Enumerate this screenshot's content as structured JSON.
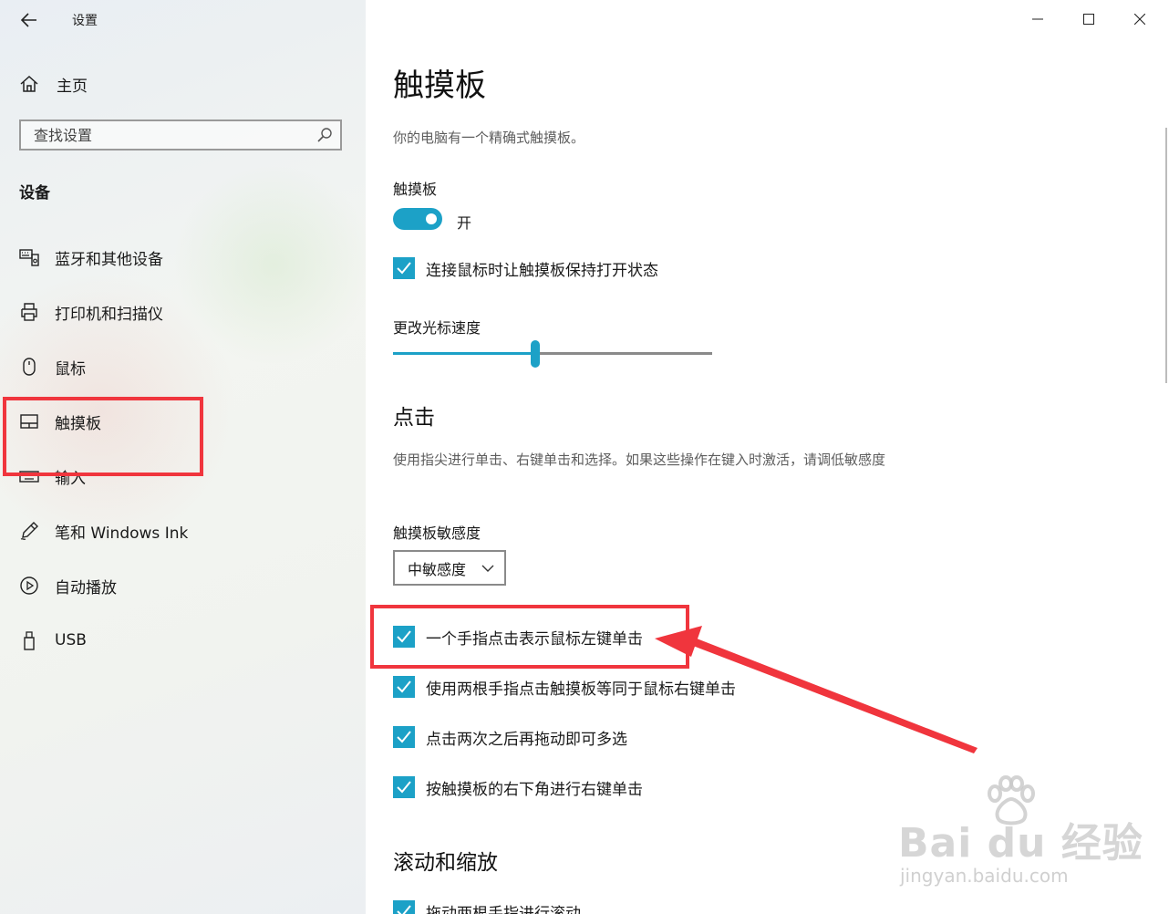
{
  "window": {
    "title": "设置",
    "controls": [
      "minimize",
      "maximize",
      "close"
    ]
  },
  "sidebar": {
    "home_label": "主页",
    "search_placeholder": "查找设置",
    "section_title": "设备",
    "items": [
      {
        "label": "蓝牙和其他设备",
        "icon": "keyboard-device-icon"
      },
      {
        "label": "打印机和扫描仪",
        "icon": "printer-icon"
      },
      {
        "label": "鼠标",
        "icon": "mouse-icon"
      },
      {
        "label": "触摸板",
        "icon": "touchpad-icon",
        "selected": true
      },
      {
        "label": "输入",
        "icon": "keyboard-icon"
      },
      {
        "label": "笔和 Windows Ink",
        "icon": "pen-icon"
      },
      {
        "label": "自动播放",
        "icon": "autoplay-icon"
      },
      {
        "label": "USB",
        "icon": "usb-icon"
      }
    ]
  },
  "main": {
    "title": "触摸板",
    "description": "你的电脑有一个精确式触摸板。",
    "touchpad_label": "触摸板",
    "toggle_state": "开",
    "toggle_on": true,
    "keep_on_label": "连接鼠标时让触摸板保持打开状态",
    "cursor_speed_label": "更改光标速度",
    "cursor_speed_fraction": 0.445,
    "taps_heading": "点击",
    "taps_description": "使用指尖进行单击、右键单击和选择。如果这些操作在键入时激活，请调低敏感度",
    "sensitivity_label": "触摸板敏感度",
    "sensitivity_value": "中敏感度",
    "tap_options": [
      {
        "label": "一个手指点击表示鼠标左键单击",
        "checked": true
      },
      {
        "label": "使用两根手指点击触摸板等同于鼠标右键单击",
        "checked": true
      },
      {
        "label": "点击两次之后再拖动即可多选",
        "checked": true
      },
      {
        "label": "按触摸板的右下角进行右键单击",
        "checked": true
      }
    ],
    "scroll_heading": "滚动和缩放",
    "scroll_option": "拖动两根手指进行滚动"
  },
  "watermark": {
    "brand": "Bai du 经验",
    "url": "jingyan.baidu.com"
  },
  "colors": {
    "accent": "#1ca1c7",
    "annotation_red": "#f0353d"
  }
}
